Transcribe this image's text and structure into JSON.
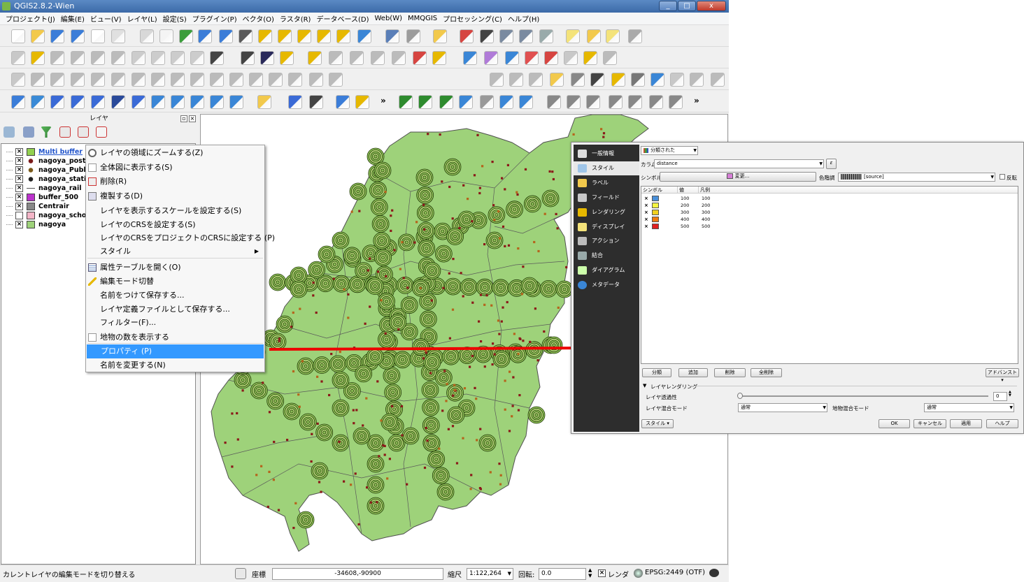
{
  "window": {
    "title": "QGIS2.8.2-Wien",
    "buttons": [
      "_",
      "□",
      "x"
    ]
  },
  "menu": [
    "プロジェクト(J)",
    "編集(E)",
    "ビュー(V)",
    "レイヤ(L)",
    "設定(S)",
    "プラグイン(P)",
    "ベクタ(O)",
    "ラスタ(R)",
    "データベース(D)",
    "Web(W)",
    "MMQGIS",
    "プロセッシング(C)",
    "ヘルプ(H)"
  ],
  "toolbar_overflow": "»",
  "layer_panel": {
    "title": "レイヤ",
    "layers": [
      {
        "name": "Multi buffer",
        "checked": true,
        "symbol": "fill",
        "color": "#92d050",
        "selected": true
      },
      {
        "name": "nagoya_postof",
        "checked": true,
        "symbol": "point",
        "color": "#7a1a1a"
      },
      {
        "name": "nagoya_Public",
        "checked": true,
        "symbol": "point",
        "color": "#7a5a1a"
      },
      {
        "name": "nagoya_station",
        "checked": true,
        "symbol": "point",
        "color": "#222222"
      },
      {
        "name": "nagoya_rail",
        "checked": true,
        "symbol": "line",
        "color": "#555555"
      },
      {
        "name": "buffer_500",
        "checked": true,
        "symbol": "fill",
        "color": "#bb33cc"
      },
      {
        "name": "Centrair",
        "checked": true,
        "symbol": "fill",
        "color": "#888888"
      },
      {
        "name": "nagoya_school",
        "checked": false,
        "symbol": "fill",
        "color": "#f4b6c8"
      },
      {
        "name": "nagoya",
        "checked": true,
        "symbol": "fill",
        "color": "#9ed27a"
      }
    ]
  },
  "context_menu": {
    "items": [
      {
        "label": "レイヤの領域にズームする(Z)",
        "icon": "zoom-layer-icon"
      },
      {
        "label": "全体図に表示する(S)",
        "icon": "checkbox-icon"
      },
      {
        "label": "削除(R)",
        "icon": "remove-icon"
      },
      {
        "label": "複製する(D)",
        "icon": "duplicate-icon"
      },
      {
        "label": "レイヤを表示するスケールを設定する(S)",
        "icon": ""
      },
      {
        "label": "レイヤのCRSを設定する(S)",
        "icon": ""
      },
      {
        "label": "レイヤのCRSをプロジェクトのCRSに設定する (P)",
        "icon": ""
      },
      {
        "label": "スタイル",
        "icon": "",
        "submenu": true
      },
      {
        "label": "属性テーブルを開く(O)",
        "icon": "table-icon"
      },
      {
        "label": "編集モード切替",
        "icon": "pencil-icon"
      },
      {
        "label": "名前をつけて保存する...",
        "icon": ""
      },
      {
        "label": "レイヤ定義ファイルとして保存する...",
        "icon": ""
      },
      {
        "label": "フィルター(F)...",
        "icon": ""
      },
      {
        "label": "地物の数を表示する",
        "icon": "checkbox-icon"
      },
      {
        "label": "プロパティ (P)",
        "icon": "",
        "selected": true
      },
      {
        "label": "名前を変更する(N)",
        "icon": ""
      }
    ]
  },
  "properties_dialog": {
    "sidebar": [
      {
        "label": "一般情報",
        "icon": "tools-icon"
      },
      {
        "label": "スタイル",
        "icon": "style-icon",
        "active": true
      },
      {
        "label": "ラベル",
        "icon": "label-icon"
      },
      {
        "label": "フィールド",
        "icon": "fields-icon"
      },
      {
        "label": "レンダリング",
        "icon": "brush-icon"
      },
      {
        "label": "ディスプレイ",
        "icon": "display-icon"
      },
      {
        "label": "アクション",
        "icon": "gear-icon"
      },
      {
        "label": "結合",
        "icon": "join-icon"
      },
      {
        "label": "ダイアグラム",
        "icon": "diagram-icon"
      },
      {
        "label": "メタデータ",
        "icon": "info-icon"
      }
    ],
    "renderer": "分類された",
    "column_label": "カラム",
    "column_value": "distance",
    "symbol_label": "シンボル",
    "symbol_change": "変更...",
    "colorramp_label": "色階調",
    "colorramp_value": "[source]",
    "invert_label": "反転",
    "table_headers": [
      "シンボル",
      "値",
      "凡例"
    ],
    "classes": [
      {
        "value": "100",
        "legend": "100",
        "color": "#4a90d9"
      },
      {
        "value": "200",
        "legend": "200",
        "color": "#f5f542"
      },
      {
        "value": "300",
        "legend": "300",
        "color": "#f0d020"
      },
      {
        "value": "400",
        "legend": "400",
        "color": "#ee7a10"
      },
      {
        "value": "500",
        "legend": "500",
        "color": "#e02020"
      }
    ],
    "buttons": {
      "classify": "分類",
      "add": "追加",
      "delete": "削除",
      "delete_all": "全削除",
      "advanced": "アドバンスト"
    },
    "layer_rendering": "レイヤレンダリング",
    "transparency_label": "レイヤ透過性",
    "transparency_value": "0",
    "blend_label": "レイヤ混合モード",
    "blend_value": "通常",
    "feature_blend_label": "地物混合モード",
    "feature_blend_value": "通常",
    "style_btn": "スタイル",
    "ok": "OK",
    "cancel": "キャンセル",
    "apply": "適用",
    "help": "ヘルプ"
  },
  "statusbar": {
    "message": "カレントレイヤの編集モードを切り替える",
    "coord_label": "座標",
    "coord_value": "-34608,-90900",
    "scale_label": "縮尺",
    "scale_value": "1:122,264",
    "rotation_label": "回転:",
    "rotation_value": "0.0",
    "render_label": "レンダ",
    "crs": "EPSG:2449 (OTF)"
  },
  "colors": {
    "map_fill": "#9ed27a",
    "buffer_ring": "#2f4d10",
    "arrow": "#ee0000",
    "selection": "#3399ff"
  }
}
